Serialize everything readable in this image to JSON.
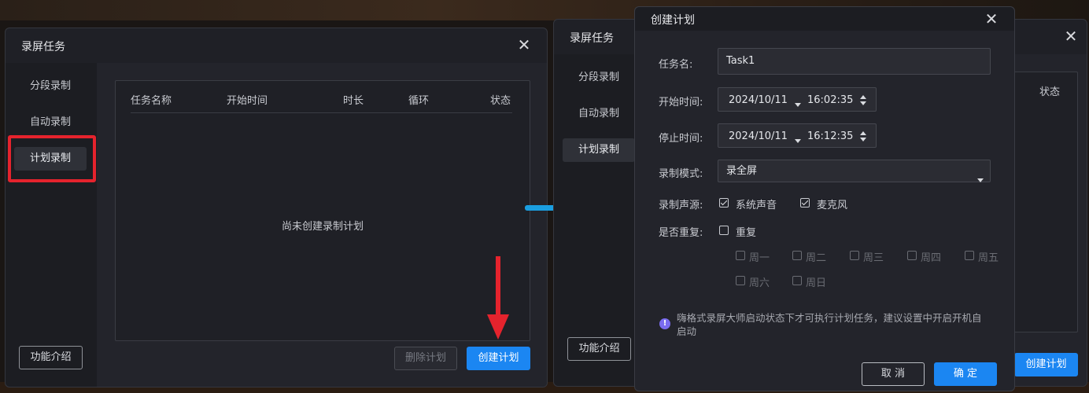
{
  "left_dialog": {
    "title": "录屏任务",
    "sidebar": [
      "分段录制",
      "自动录制",
      "计划录制"
    ],
    "active_index": 2,
    "table_headers": [
      "任务名称",
      "开始时间",
      "时长",
      "循环",
      "状态"
    ],
    "empty_text": "尚未创建录制计划",
    "intro_button": "功能介绍",
    "delete_button": "删除计划",
    "create_button": "创建计划"
  },
  "right_back_dialog": {
    "title": "录屏任务",
    "sidebar": [
      "分段录制",
      "自动录制",
      "计划录制"
    ],
    "status_header": "状态",
    "intro_button": "功能介绍",
    "create_button": "创建计划"
  },
  "create_dialog": {
    "title": "创建计划",
    "task_name_label": "任务名:",
    "task_name_value": "Task1",
    "start_label": "开始时间:",
    "start_date": "2024/10/11",
    "start_time": "16:02:35",
    "stop_label": "停止时间:",
    "stop_date": "2024/10/11",
    "stop_time": "16:12:35",
    "mode_label": "录制模式:",
    "mode_value": "录全屏",
    "source_label": "录制声源:",
    "source_system": "系统声音",
    "source_mic": "麦克风",
    "repeat_label": "是否重复:",
    "repeat_text": "重复",
    "weekdays": [
      "周一",
      "周二",
      "周三",
      "周四",
      "周五",
      "周六",
      "周日"
    ],
    "note": "嗨格式录屏大师启动状态下才可执行计划任务，建议设置中开启开机自启动",
    "cancel_button": "取 消",
    "ok_button": "确 定"
  },
  "colors": {
    "accent": "#1b86f2",
    "highlight_red": "#e5232d",
    "arrow_blue": "#1a9ee0"
  },
  "icons": [
    "close-icon",
    "caret-down-icon",
    "spinner-icon",
    "checkbox-icon",
    "info-icon",
    "arrow-right-icon",
    "arrow-down-icon"
  ]
}
